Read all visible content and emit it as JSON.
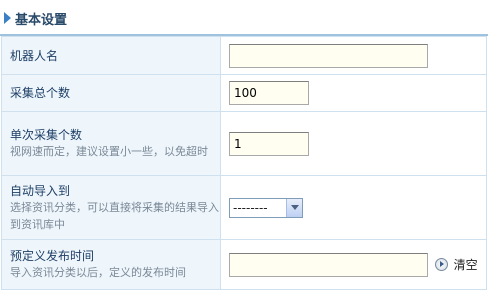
{
  "header": {
    "title": "基本设置"
  },
  "rows": [
    {
      "label": "机器人名",
      "desc": "",
      "value": ""
    },
    {
      "label": "采集总个数",
      "desc": "",
      "value": "100"
    },
    {
      "label": "单次采集个数",
      "desc": "视网速而定，建议设置小一些，以免超时",
      "value": "1"
    },
    {
      "label": "自动导入到",
      "desc": "选择资讯分类，可以直接将采集的结果导入到资讯库中",
      "select_value": "--------"
    },
    {
      "label": "预定义发布时间",
      "desc": "导入资讯分类以后，定义的发布时间",
      "value": "",
      "clear_label": "清空"
    }
  ],
  "colors": {
    "label_bg": "#eef6fc",
    "border": "#cfe0ee",
    "input_bg": "#fffef0",
    "accent": "#3b7fc4"
  }
}
